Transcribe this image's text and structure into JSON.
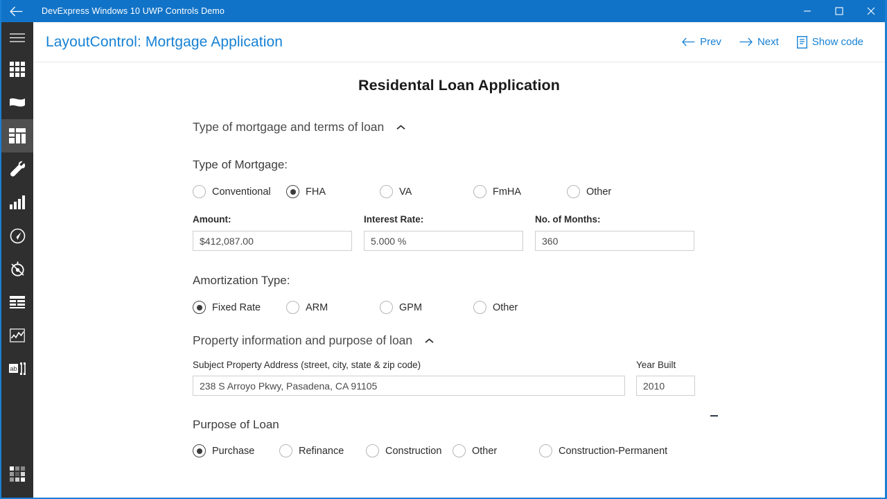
{
  "titlebar": {
    "back_icon": "arrow-left-icon",
    "title": "DevExpress Windows 10 UWP Controls Demo",
    "minimize_label": "—",
    "maximize_label": "☐",
    "close_label": "✕"
  },
  "accent_color": "#1173c7",
  "link_color": "#1681d4",
  "rail": {
    "items": [
      {
        "icon": "hamburger-menu-icon",
        "name": "menu-toggle",
        "selected": false
      },
      {
        "icon": "grid-apps-icon",
        "name": "rail-item-apps",
        "selected": false
      },
      {
        "icon": "ribbon-flag-icon",
        "name": "rail-item-ribbon",
        "selected": false
      },
      {
        "icon": "layout-control-icon",
        "name": "rail-item-layout",
        "selected": true
      },
      {
        "icon": "wrench-icon",
        "name": "rail-item-tools",
        "selected": false
      },
      {
        "icon": "bar-chart-icon",
        "name": "rail-item-charts",
        "selected": false
      },
      {
        "icon": "gauge-icon",
        "name": "rail-item-gauges",
        "selected": false
      },
      {
        "icon": "compass-icon",
        "name": "rail-item-navigation",
        "selected": false
      },
      {
        "icon": "table-grid-icon",
        "name": "rail-item-datagrid",
        "selected": false
      },
      {
        "icon": "sparkline-icon",
        "name": "rail-item-sparkline",
        "selected": false
      },
      {
        "icon": "text-editor-icon",
        "name": "rail-item-editors",
        "selected": false
      }
    ],
    "footer_icon": "app-tiles-icon"
  },
  "header": {
    "title": "LayoutControl: Mortgage Application",
    "actions": [
      {
        "icon": "arrow-left-icon",
        "label": "Prev",
        "name": "prev-button"
      },
      {
        "icon": "arrow-right-icon",
        "label": "Next",
        "name": "next-button"
      },
      {
        "icon": "document-icon",
        "label": "Show code",
        "name": "show-code-button"
      }
    ]
  },
  "form": {
    "document_title": "Residental Loan Application",
    "groups": [
      {
        "title": "Type of mortgage and terms of loan",
        "expanded": true,
        "chevron": "chevron-up-icon"
      },
      {
        "title": "Property information and purpose of loan",
        "expanded": true,
        "chevron": "chevron-up-icon"
      }
    ],
    "type_of_mortgage": {
      "label": "Type of Mortgage:",
      "options": [
        {
          "label": "Conventional",
          "checked": false
        },
        {
          "label": "FHA",
          "checked": true
        },
        {
          "label": "VA",
          "checked": false
        },
        {
          "label": "FmHA",
          "checked": false
        },
        {
          "label": "Other",
          "checked": false
        }
      ]
    },
    "terms": [
      {
        "label": "Amount:",
        "value": "$412,087.00",
        "name": "amount-input"
      },
      {
        "label": "Interest Rate:",
        "value": "5.000 %",
        "name": "interest-rate-input"
      },
      {
        "label": "No. of Months:",
        "value": "360",
        "name": "months-input"
      }
    ],
    "amortization_type": {
      "label": "Amortization Type:",
      "options": [
        {
          "label": "Fixed Rate",
          "checked": true
        },
        {
          "label": "ARM",
          "checked": false
        },
        {
          "label": "GPM",
          "checked": false
        },
        {
          "label": "Other",
          "checked": false
        }
      ]
    },
    "property": {
      "address_label": "Subject Property Address (street, city, state & zip code)",
      "address_value": "238 S Arroyo Pkwy, Pasadena, CA 91105",
      "year_built_label": "Year Built",
      "year_built_value": "2010"
    },
    "purpose_of_loan": {
      "label": "Purpose of Loan",
      "options": [
        {
          "label": "Purchase",
          "checked": true
        },
        {
          "label": "Refinance",
          "checked": false
        },
        {
          "label": "Construction",
          "checked": false
        },
        {
          "label": "Other",
          "checked": false
        },
        {
          "label": "Construction-Permanent",
          "checked": false
        }
      ]
    }
  }
}
